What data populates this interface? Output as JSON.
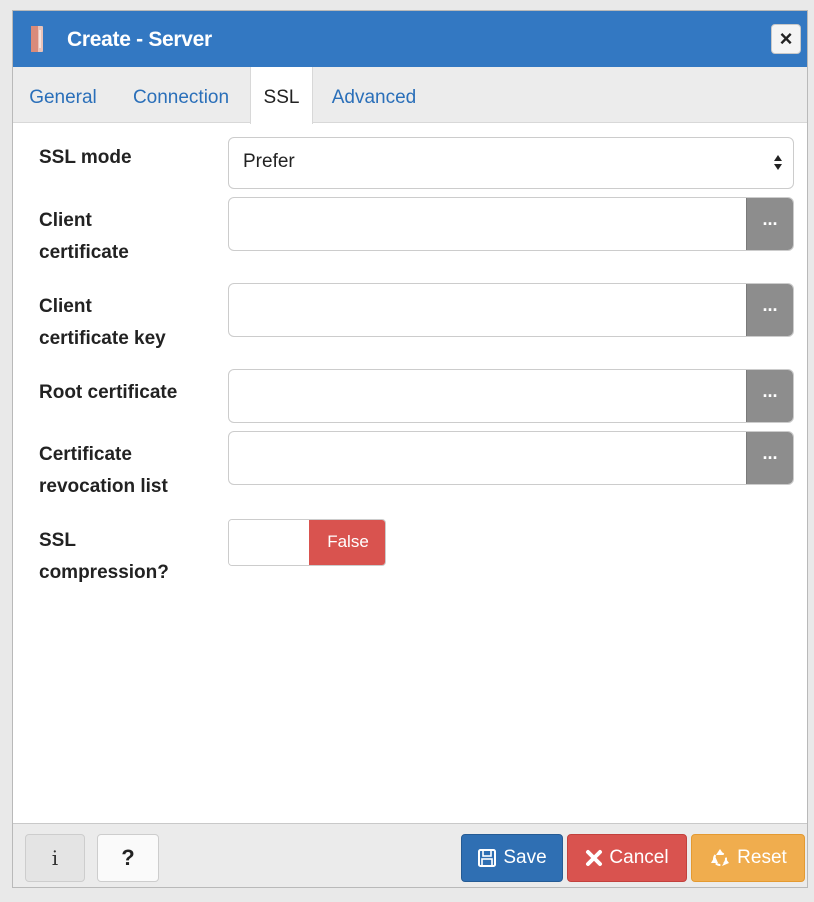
{
  "dialog": {
    "title": "Create - Server",
    "close_glyph": "×"
  },
  "tabs": [
    {
      "label": "General"
    },
    {
      "label": "Connection"
    },
    {
      "label": "SSL"
    },
    {
      "label": "Advanced"
    }
  ],
  "active_tab": "SSL",
  "form": {
    "ssl_mode": {
      "label": "SSL mode",
      "value": "Prefer"
    },
    "client_certificate": {
      "label_line1": "Client",
      "label_line2": "certificate",
      "value": "",
      "browse": "···"
    },
    "client_certificate_key": {
      "label_line1": "Client",
      "label_line2": "certificate key",
      "value": "",
      "browse": "···"
    },
    "root_certificate": {
      "label": "Root certificate",
      "value": "",
      "browse": "···"
    },
    "crl": {
      "label_line1": "Certificate",
      "label_line2": "revocation list",
      "value": "",
      "browse": "···"
    },
    "ssl_compression": {
      "label_line1": "SSL",
      "label_line2": "compression?",
      "value": "False"
    }
  },
  "footer": {
    "info_label": "i",
    "help_label": "?",
    "save_label": "Save",
    "cancel_label": "Cancel",
    "reset_label": "Reset"
  },
  "colors": {
    "titlebar": "#3378c2",
    "tab_link": "#2a6fb9",
    "save": "#2f6fb3",
    "cancel": "#d9534f",
    "reset": "#f0ad4e",
    "toggle_false": "#d9534f"
  }
}
